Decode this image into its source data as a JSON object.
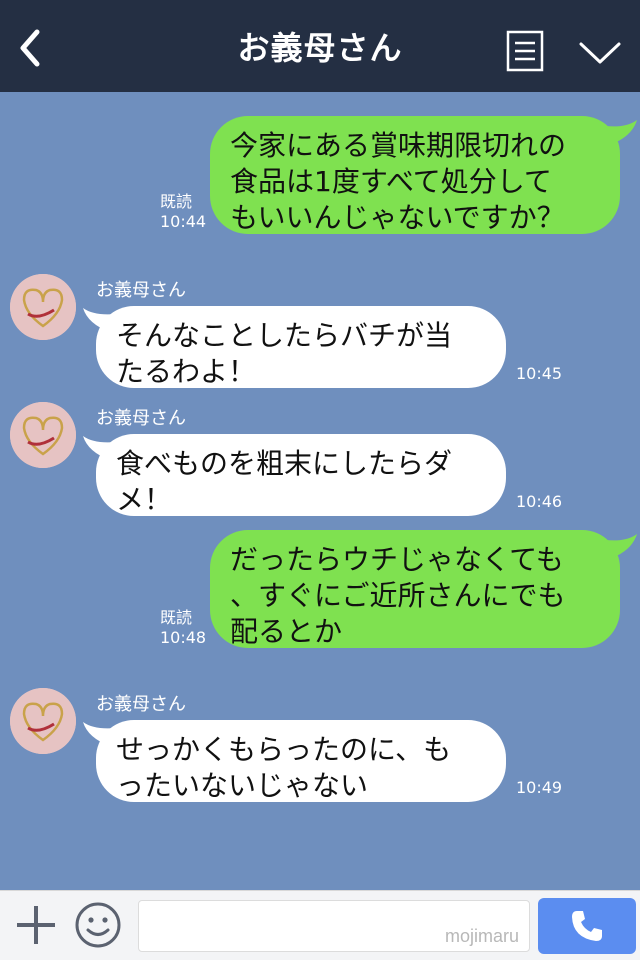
{
  "header": {
    "title": "お義母さん"
  },
  "messages": [
    {
      "from": "me",
      "text": "今家にある賞味期限切れの\n食品は1度すべて処分して\nもいいんじゃないですか？",
      "read": "既読",
      "time": "10:44"
    },
    {
      "from": "them",
      "sender": "お義母さん",
      "text": "そんなことしたらバチが当\nたるわよ！",
      "time": "10:45"
    },
    {
      "from": "them",
      "sender": "お義母さん",
      "text": "食べものを粗末にしたらダ\nメ！",
      "time": "10:46"
    },
    {
      "from": "me",
      "text": "だったらウチじゃなくても\n、すぐにご近所さんにでも\n配るとか",
      "read": "既読",
      "time": "10:48"
    },
    {
      "from": "them",
      "sender": "お義母さん",
      "text": "せっかくもらったのに、も\nったいないじゃない",
      "time": "10:49"
    }
  ],
  "footer": {
    "watermark": "mojimaru"
  },
  "colors": {
    "header_bg": "#242f43",
    "chat_bg": "#6f8fbe",
    "my_bubble": "#7fe150",
    "their_bubble": "#ffffff",
    "call_button": "#5b8df0"
  }
}
